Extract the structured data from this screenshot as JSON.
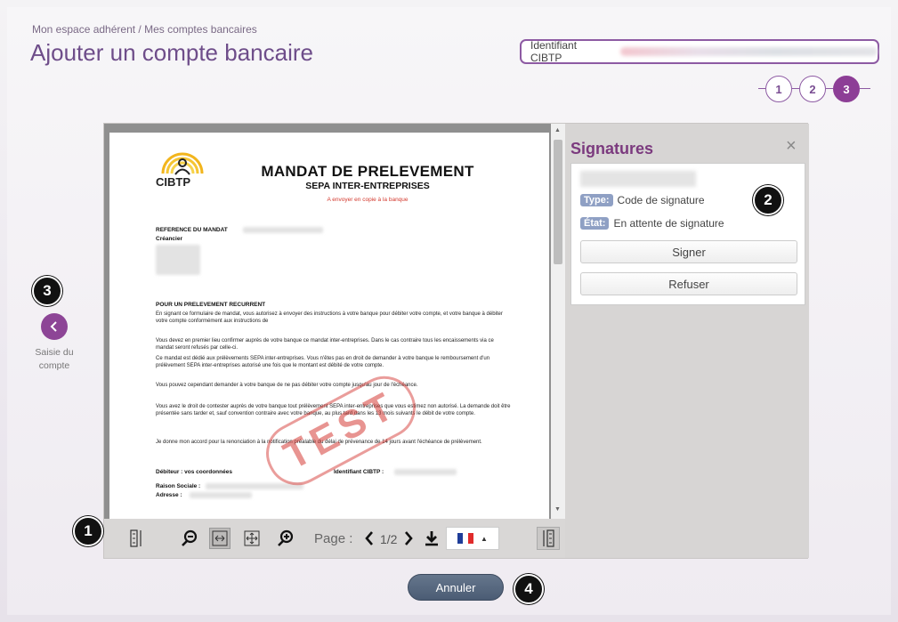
{
  "header": {
    "breadcrumb": "Mon espace adhérent / Mes comptes bancaires",
    "title": "Ajouter un compte bancaire",
    "id_label": "Identifiant CIBTP"
  },
  "steps": [
    "1",
    "2",
    "3"
  ],
  "document": {
    "logo": "CIBTP",
    "title": "MANDAT DE PRELEVEMENT",
    "subtitle": "SEPA INTER-ENTREPRISES",
    "note": "A envoyer en copie à la banque",
    "ref_label": "REFERENCE DU MANDAT",
    "creancier_label": "Créancier",
    "section_title": "POUR UN PRELEVEMENT RECURRENT",
    "p1": "En signant ce formulaire de mandat, vous autorisez                                   à envoyer des instructions à votre banque pour débiter votre compte, et votre banque à débiter votre compte conformément aux instructions de",
    "p2": "Vous devez en premier lieu confirmer auprès de votre banque ce mandat inter-entreprises. Dans le cas contraire tous les encaissements via ce mandat seront refusés par celle-ci.",
    "p3": "Ce mandat est dédié aux prélèvements SEPA inter-entreprises. Vous n'êtes pas en droit de demander à votre banque le remboursement d'un prélèvement SEPA inter-entreprises autorisé une fois que le montant est débité de votre compte.",
    "p4": "Vous pouvez cependant demander à votre banque de ne pas débiter votre compte jusqu'au jour de l'échéance.",
    "p5": "Vous avez le droit de contester auprès de votre banque tout prélèvement SEPA inter-entreprises que vous estimez non autorisé. La demande doit être présentée sans tarder et, sauf convention contraire avec votre banque, au plus tard dans les 13 mois suivants le débit de votre compte.",
    "p6": "Je donne mon accord pour la renonciation à la notification préalable du délai de prévenance de 14 jours avant l'échéance de prélèvement.",
    "debiteur_label": "Débiteur : vos coordonnées",
    "id_cibtp_label": "Identifiant CIBTP :",
    "raison_label": "Raison Sociale :",
    "adresse_label": "Adresse :",
    "stamp": "TEST"
  },
  "toolbar": {
    "page_label": "Page :",
    "page_count": "1/2"
  },
  "signatures": {
    "title": "Signatures",
    "close": "×",
    "type_tag": "Type:",
    "type_value": "Code de signature",
    "state_tag": "État:",
    "state_value": "En attente de signature",
    "sign_button": "Signer",
    "refuse_button": "Refuser"
  },
  "nav": {
    "back_label_1": "Saisie du",
    "back_label_2": "compte"
  },
  "cancel_button": "Annuler",
  "markers": [
    "1",
    "2",
    "3",
    "4"
  ],
  "colors": {
    "brand": "#8d3e96",
    "title": "#6e4d8a",
    "cancel": "#56677e",
    "tag": "#8fa0c4"
  }
}
